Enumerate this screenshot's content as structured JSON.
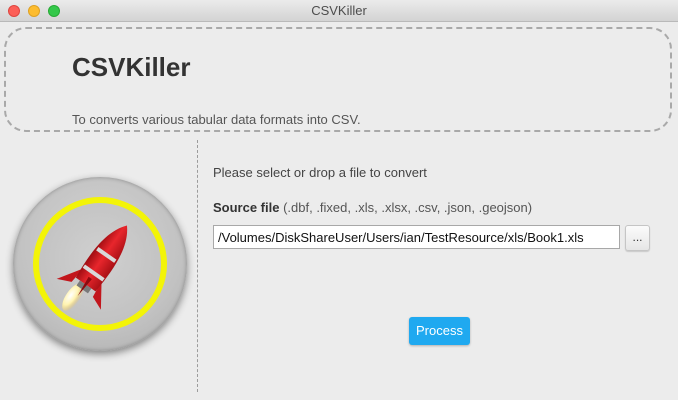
{
  "window": {
    "title": "CSVKiller"
  },
  "header": {
    "app_name": "CSVKiller",
    "description": "To converts various tabular data formats into CSV."
  },
  "main": {
    "prompt": "Please select or drop a file to convert",
    "source_label": "Source file",
    "source_formats": " (.dbf, .fixed, .xls, .xlsx, .csv, .json, .geojson)",
    "file_path": "/Volumes/DiskShareUser/Users/ian/TestResource/xls/Book1.xls",
    "browse_label": "...",
    "process_label": "Process"
  },
  "colors": {
    "accent": "#1fa9f0",
    "logo_ring": "#f3f407",
    "rocket": "#d8171e"
  },
  "icons": {
    "logo": "rocket-icon"
  }
}
